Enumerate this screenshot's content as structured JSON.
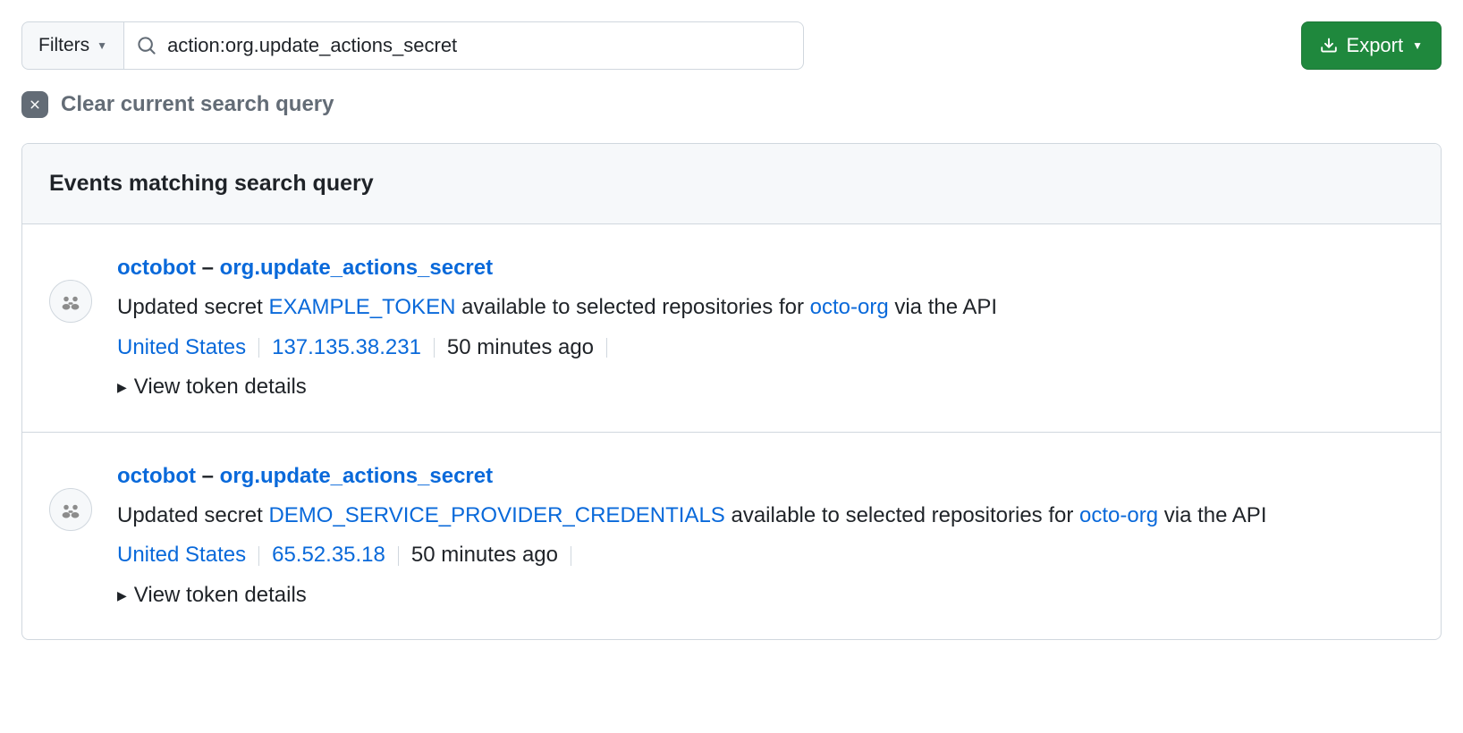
{
  "toolbar": {
    "filters_label": "Filters",
    "search_value": "action:org.update_actions_secret",
    "export_label": "Export"
  },
  "clear": {
    "label": "Clear current search query"
  },
  "panel": {
    "title": "Events matching search query"
  },
  "text": {
    "updated_secret_prefix": "Updated secret ",
    "available_to": " available to selected repositories for ",
    "via_api": " via the API",
    "view_token_details": "View token details",
    "dash": " – "
  },
  "events": [
    {
      "actor": "octobot",
      "action": "org.update_actions_secret",
      "secret_name": "EXAMPLE_TOKEN",
      "org": "octo-org",
      "location": "United States",
      "ip": "137.135.38.231",
      "time": "50 minutes ago"
    },
    {
      "actor": "octobot",
      "action": "org.update_actions_secret",
      "secret_name": "DEMO_SERVICE_PROVIDER_CREDENTIALS",
      "org": "octo-org",
      "location": "United States",
      "ip": "65.52.35.18",
      "time": "50 minutes ago"
    }
  ]
}
